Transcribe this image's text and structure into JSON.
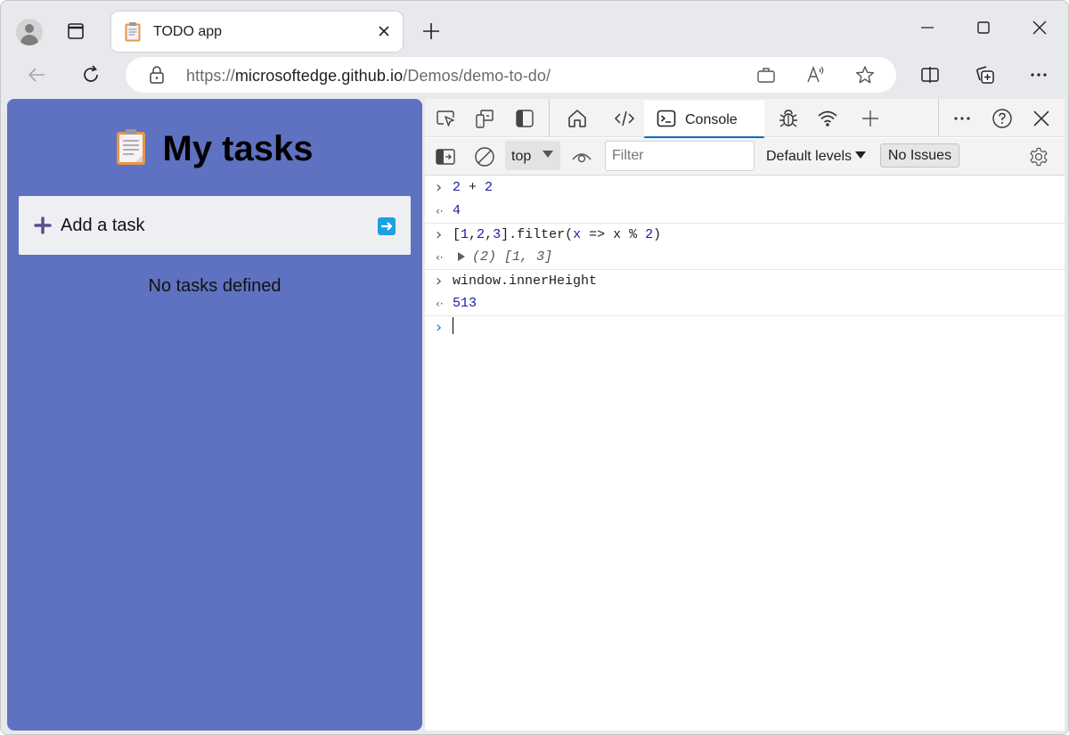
{
  "browser": {
    "tab": {
      "title": "TODO app",
      "favicon": "clipboard-icon"
    },
    "address": {
      "scheme_prefix": "https://",
      "host": "microsoftedge.github.io",
      "path": "/Demos/demo-to-do/"
    },
    "icons": {
      "profile": "avatar-icon",
      "tab_actions": "tab-actions-icon",
      "close_tab": "close-icon",
      "new_tab": "plus-icon",
      "minimize": "minimize-icon",
      "maximize": "maximize-icon",
      "close_window": "close-icon",
      "back": "back-arrow-icon",
      "refresh": "refresh-icon",
      "lock": "lock-icon",
      "app_available": "briefcase-icon",
      "read_aloud": "read-aloud-icon",
      "favorite": "star-icon",
      "split_screen": "split-screen-icon",
      "collections": "collections-icon",
      "more": "ellipsis-icon"
    }
  },
  "page": {
    "title": "My tasks",
    "add_task_label": "Add a task",
    "empty_message": "No tasks defined",
    "background_color": "#5f72c1"
  },
  "devtools": {
    "tabs": [
      {
        "label": "Console",
        "active": true
      }
    ],
    "filter": {
      "context": "top",
      "placeholder": "Filter",
      "value": ""
    },
    "levels_label": "Default levels",
    "issues_label": "No Issues",
    "accent_color": "#0f6cbd",
    "console": [
      {
        "type": "input",
        "tokens": [
          {
            "t": "2",
            "c": "num"
          },
          {
            "t": " + ",
            "c": ""
          },
          {
            "t": "2",
            "c": "num"
          }
        ]
      },
      {
        "type": "output",
        "tokens": [
          {
            "t": "4",
            "c": "num"
          }
        ]
      },
      {
        "type": "input",
        "tokens": [
          {
            "t": "[",
            "c": ""
          },
          {
            "t": "1",
            "c": "num"
          },
          {
            "t": ",",
            "c": ""
          },
          {
            "t": "2",
            "c": "num"
          },
          {
            "t": ",",
            "c": ""
          },
          {
            "t": "3",
            "c": "num"
          },
          {
            "t": "].filter(",
            "c": ""
          },
          {
            "t": "x",
            "c": "blue"
          },
          {
            "t": " => x % ",
            "c": ""
          },
          {
            "t": "2",
            "c": "num"
          },
          {
            "t": ")",
            "c": ""
          }
        ]
      },
      {
        "type": "output-array",
        "length_label": "(2)",
        "tokens": [
          {
            "t": "[",
            "c": "ital"
          },
          {
            "t": "1",
            "c": "num ital"
          },
          {
            "t": ", ",
            "c": "ital"
          },
          {
            "t": "3",
            "c": "num ital"
          },
          {
            "t": "]",
            "c": "ital"
          }
        ]
      },
      {
        "type": "input",
        "tokens": [
          {
            "t": "window.innerHeight",
            "c": ""
          }
        ]
      },
      {
        "type": "output",
        "tokens": [
          {
            "t": "513",
            "c": "num"
          }
        ]
      }
    ]
  }
}
